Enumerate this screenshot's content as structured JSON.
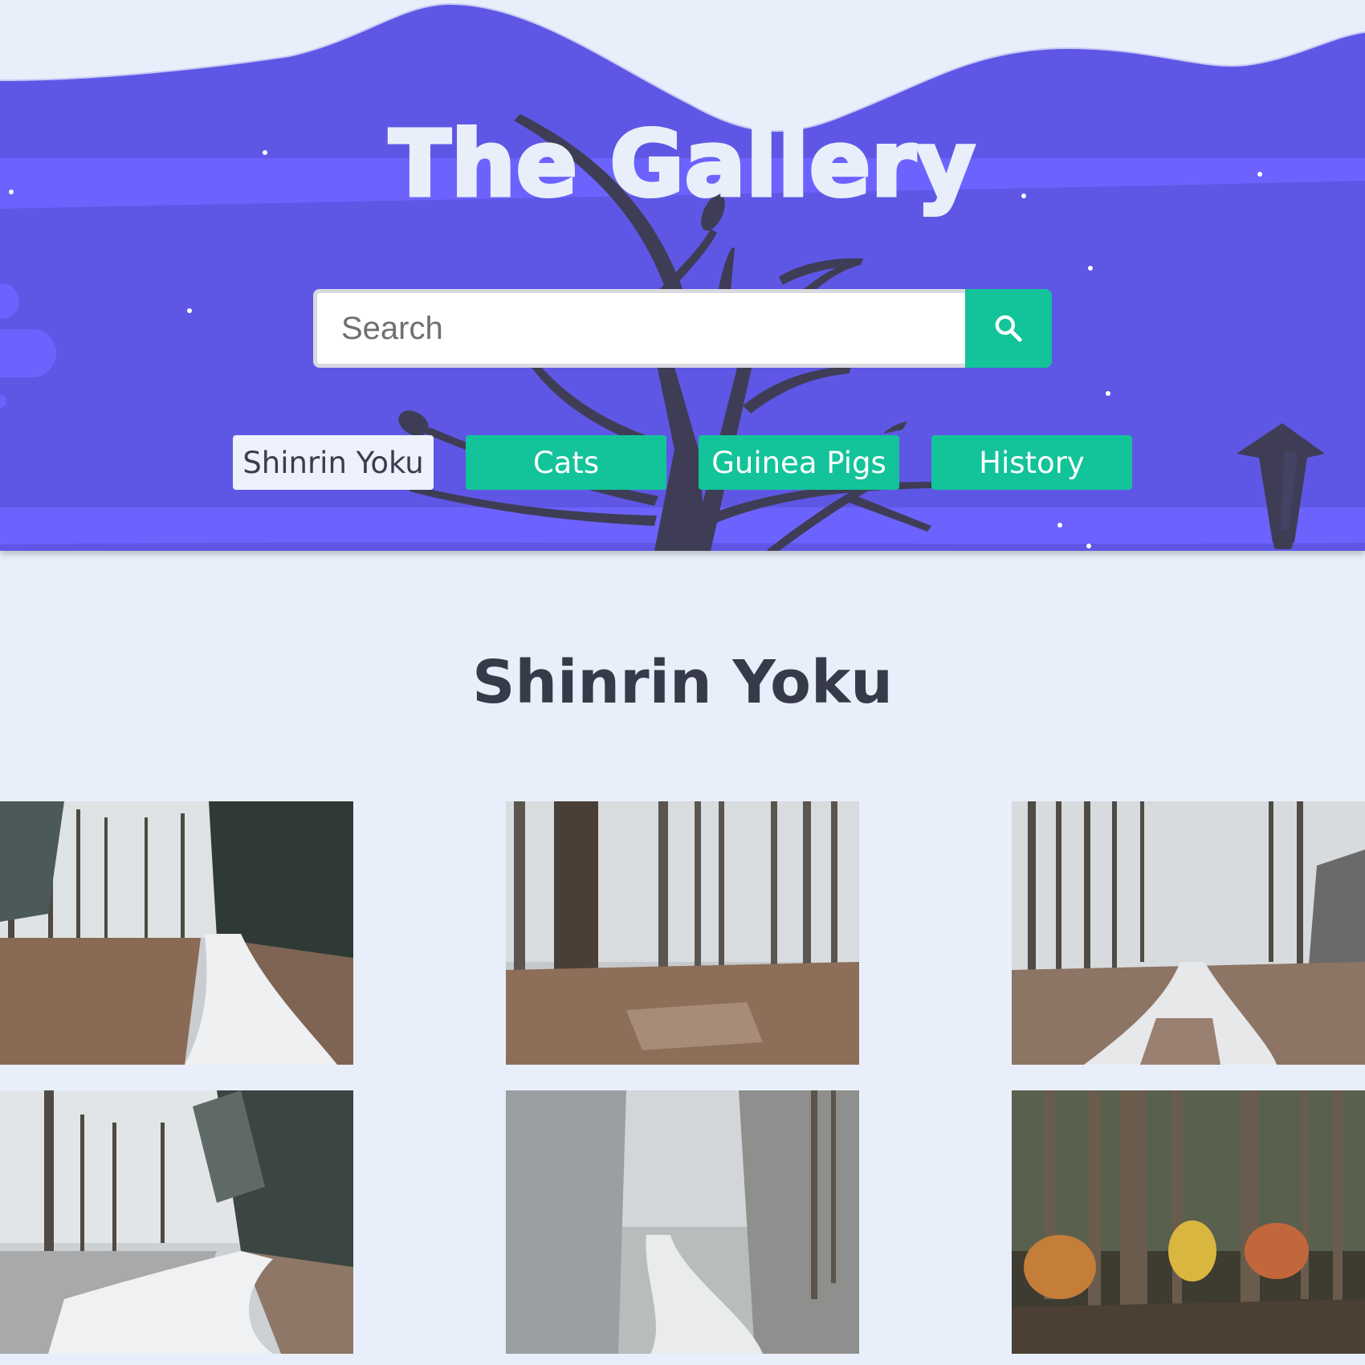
{
  "header": {
    "title": "The Gallery",
    "search": {
      "placeholder": "Search",
      "button_icon": "search-icon"
    },
    "tags": [
      {
        "label": "Shinrin Yoku",
        "active": true
      },
      {
        "label": "Cats",
        "active": false
      },
      {
        "label": "Guinea Pigs",
        "active": false
      },
      {
        "label": "History",
        "active": false
      }
    ]
  },
  "main": {
    "section_title": "Shinrin Yoku",
    "photos": [
      {
        "description": "snowy forest path bending right"
      },
      {
        "description": "misty forest with tall trunks"
      },
      {
        "description": "frosted forest path into fog"
      },
      {
        "description": "snowy path under fir trees"
      },
      {
        "description": "winding snowy track in frosted woods"
      },
      {
        "description": "autumn forest with orange undergrowth"
      }
    ]
  },
  "colors": {
    "background": "#e8effa",
    "header": "#5e57e5",
    "accent": "#13c39a",
    "title_text": "#e8effa",
    "heading_text": "#373b49"
  }
}
